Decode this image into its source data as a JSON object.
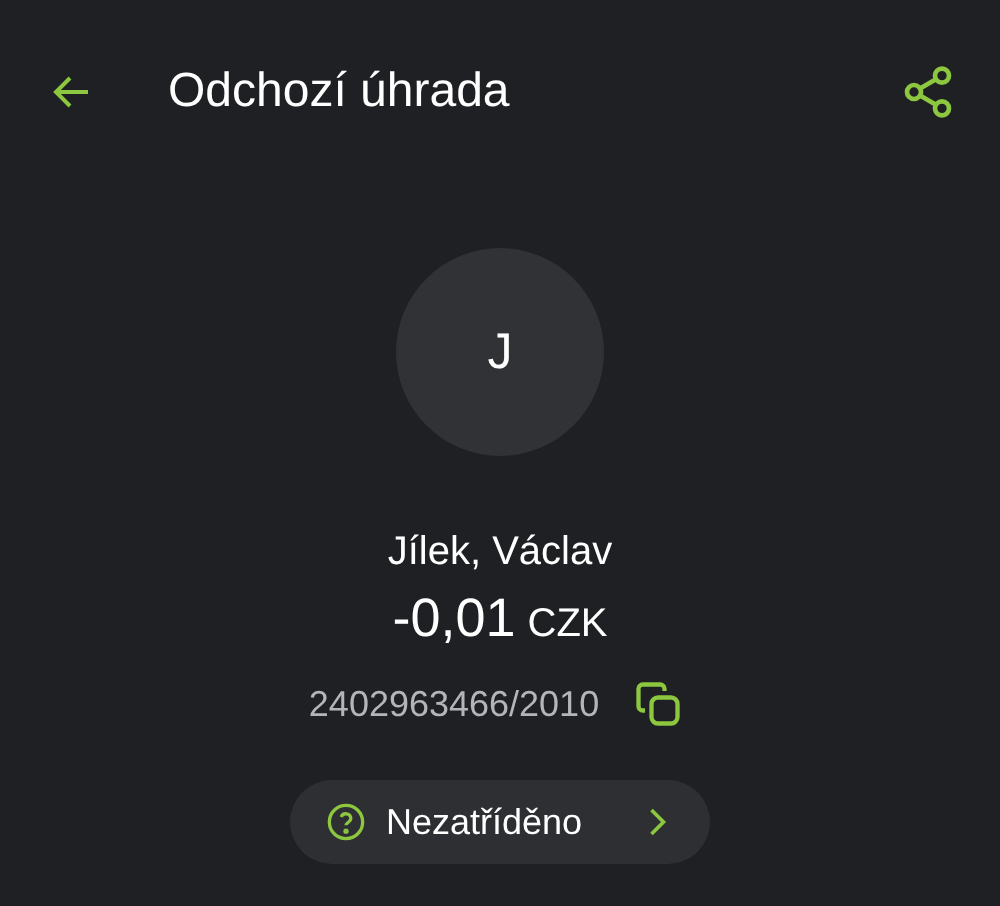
{
  "header": {
    "title": "Odchozí úhrada"
  },
  "counterparty": {
    "initial": "J",
    "name": "Jílek, Václav",
    "amount": "-0,01",
    "currency": "CZK",
    "account": "2402963466/2010"
  },
  "category": {
    "label": "Nezatříděno"
  }
}
